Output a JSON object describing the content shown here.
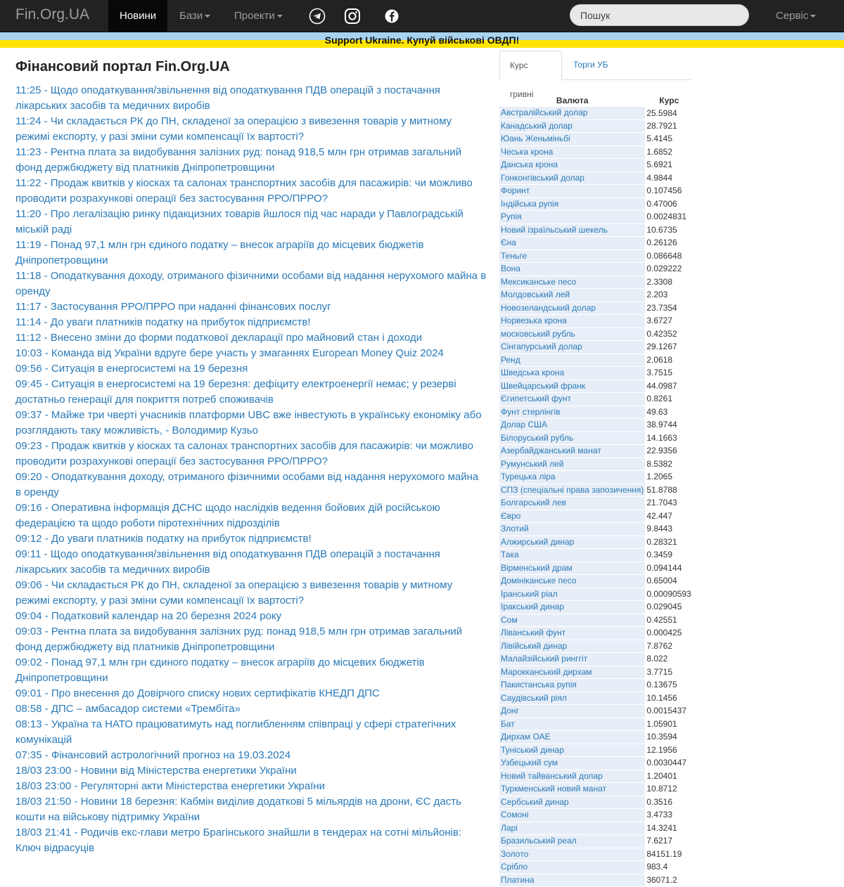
{
  "navbar": {
    "brand": "Fin.Org.UA",
    "active_item": "Новини",
    "items": [
      "Бази",
      "Проекти"
    ],
    "search_placeholder": "Пошук",
    "service": "Сервіс",
    "social": [
      "telegram-icon",
      "instagram-icon",
      "facebook-icon"
    ]
  },
  "banner": {
    "text": "Support Ukraine. Купуй військові ОВДП!",
    "colors": [
      "#a8d3ef",
      "#ffe500"
    ]
  },
  "page_title": "Фінансовий портал Fin.Org.UA",
  "news": [
    "11:25 - Щодо оподаткування/звільнення від оподаткування ПДВ операцій з постачання лікарських засобів та медичних виробів",
    "11:24 - Чи складається РК до ПН, складеної за операцією з вивезення товарів у митному режимі експорту, у разі зміни суми компенсації їх вартості?",
    "11:23 - Рентна плата за видобування залізних руд: понад 918,5 млн грн отримав загальний фонд держбюджету від платників Дніпропетровщини",
    "11:22 - Продаж квитків у кіосках та салонах транспортних засобів для пасажирів: чи можливо проводити розрахункові операції без застосування РРО/ПРРО?",
    "11:20 - Про легалізацію ринку підакцизних товарів йшлося під час наради у Павлоградській міській раді",
    "11:19 - Понад 97,1 млн грн єдиного податку – внесок аграріїв до місцевих бюджетів Дніпропетровщини",
    "11:18 - Оподаткування доходу, отриманого фізичними особами від надання нерухомого майна в оренду",
    "11:17 - Застосування РРО/ПРРО при наданні фінансових послуг",
    "11:14 - До уваги платників податку на прибуток підприємств!",
    "11:12 - Внесено зміни до форми податкової декларації про майновий стан і доходи",
    "10:03 - Команда від України вдруге бере участь у змаганнях European Money Quiz 2024",
    "09:56 - Ситуація в енергосистемі на 19 березня",
    "09:45 - Ситуація в енергосистемі на 19 березня: дефіциту електроенергії немає; у резерві достатньо генерації для покриття потреб споживачів",
    "09:37 - Майже три чверті учасників платформи UBC вже інвестують в українську економіку або розглядають таку можливість, - Володимир Кузьо",
    "09:23 - Продаж квитків у кіосках та салонах транспортних засобів для пасажирів: чи можливо проводити розрахункові операції без застосування РРО/ПРРО?",
    "09:20 - Оподаткування доходу, отриманого фізичними особами від надання нерухомого майна в оренду",
    "09:16 - Оперативна інформація ДСНС щодо наслідків ведення бойових дій російською федерацією та щодо роботи піротехнічних підрозділів",
    "09:12 - До уваги платників податку на прибуток підприємств!",
    "09:11 - Щодо оподаткування/звільнення від оподаткування ПДВ операцій з постачання лікарських засобів та медичних виробів",
    "09:06 - Чи складається РК до ПН, складеної за операцією з вивезення товарів у митному режимі експорту, у разі зміни суми компенсації їх вартості?",
    "09:04 - Податковий календар на 20 березня 2024 року",
    "09:03 - Рентна плата за видобування залізних руд: понад 918,5 млн грн отримав загальний фонд держбюджету від платників Дніпропетровщини",
    "09:02 - Понад 97,1 млн грн єдиного податку – внесок аграріїв до місцевих бюджетів Дніпропетровщини",
    "09:01 - Про внесення до Довірчого списку нових сертифікатів КНЕДП ДПС",
    "08:58 - ДПС – амбасадор системи «Трембіта»",
    "08:13 - Україна та НАТО працюватимуть над поглибленням співпраці у сфері стратегічних комунікацій",
    "07:35 - Фінансовий астрологічний прогноз на 19.03.2024",
    "18/03 23:00 - Новини від Міністерства енергетики України",
    "18/03 23:00 - Регуляторні акти Міністерства енергетики України",
    "18/03 21:50 - Новини 18 березня: Кабмін виділив додаткові 5 мільярдів на дрони, ЄС дасть кошти на військову підтримку України",
    "18/03 21:41 - Родичів екс-глави метро Брагінського знайшли в тендерах на сотні мільйонів: Ключ відрасуців"
  ],
  "sidebar": {
    "tabs": [
      "Курс гривні",
      "Торги УБ"
    ],
    "table_headers": [
      "Валюта",
      "Курс"
    ],
    "rates": [
      [
        "Австралійський долар",
        "25.5984"
      ],
      [
        "Канадський долар",
        "28.7921"
      ],
      [
        "Юань Женьміньбі",
        "5.4145"
      ],
      [
        "Чеська крона",
        "1.6852"
      ],
      [
        "Данська крона",
        "5.6921"
      ],
      [
        "Гонконгівський долар",
        "4.9844"
      ],
      [
        "Форинт",
        "0.107456"
      ],
      [
        "Індійська рупія",
        "0.47006"
      ],
      [
        "Рупія",
        "0.0024831"
      ],
      [
        "Новий ізраїльський шекель",
        "10.6735"
      ],
      [
        "Єна",
        "0.26126"
      ],
      [
        "Теньге",
        "0.086648"
      ],
      [
        "Вона",
        "0.029222"
      ],
      [
        "Мексиканське песо",
        "2.3308"
      ],
      [
        "Молдовський лей",
        "2.203"
      ],
      [
        "Новозеландський долар",
        "23.7354"
      ],
      [
        "Норвезька крона",
        "3.6727"
      ],
      [
        "московський рубль",
        "0.42352"
      ],
      [
        "Сінгапурський долар",
        "29.1267"
      ],
      [
        "Ренд",
        "2.0618"
      ],
      [
        "Шведська крона",
        "3.7515"
      ],
      [
        "Швейцарський франк",
        "44.0987"
      ],
      [
        "Єгипетський фунт",
        "0.8261"
      ],
      [
        "Фунт стерлінгів",
        "49.63"
      ],
      [
        "Долар США",
        "38.9744"
      ],
      [
        "Білоруський рубль",
        "14.1663"
      ],
      [
        "Азербайджанський манат",
        "22.9356"
      ],
      [
        "Румунський лей",
        "8.5382"
      ],
      [
        "Турецька ліра",
        "1.2065"
      ],
      [
        "СПЗ (спеціальні права запозичення)",
        "51.8788"
      ],
      [
        "Болгарський лев",
        "21.7043"
      ],
      [
        "Євро",
        "42.447"
      ],
      [
        "Злотий",
        "9.8443"
      ],
      [
        "Алжирський динар",
        "0.28321"
      ],
      [
        "Така",
        "0.3459"
      ],
      [
        "Вірменський драм",
        "0.094144"
      ],
      [
        "Домініканське песо",
        "0.65004"
      ],
      [
        "Іранський ріал",
        "0.00090593"
      ],
      [
        "Іракський динар",
        "0.029045"
      ],
      [
        "Сом",
        "0.42551"
      ],
      [
        "Ліванський фунт",
        "0.000425"
      ],
      [
        "Лівійський динар",
        "7.8762"
      ],
      [
        "Малайзійський ринггіт",
        "8.022"
      ],
      [
        "Марокканський дирхам",
        "3.7715"
      ],
      [
        "Пакистанська рупія",
        "0.13675"
      ],
      [
        "Саудівський ріял",
        "10.1456"
      ],
      [
        "Донг",
        "0.0015437"
      ],
      [
        "Бат",
        "1.05901"
      ],
      [
        "Дирхам ОАЕ",
        "10.3594"
      ],
      [
        "Туніський динар",
        "12.1956"
      ],
      [
        "Узбецький сум",
        "0.0030447"
      ],
      [
        "Новий тайванський долар",
        "1.20401"
      ],
      [
        "Туркменський новий манат",
        "10.8712"
      ],
      [
        "Сербський динар",
        "0.3516"
      ],
      [
        "Сомоні",
        "3.4733"
      ],
      [
        "Ларі",
        "14.3241"
      ],
      [
        "Бразильський реал",
        "7.6217"
      ],
      [
        "Золото",
        "84151.19"
      ],
      [
        "Срібло",
        "983.4"
      ],
      [
        "Платина",
        "36071.2"
      ]
    ]
  }
}
